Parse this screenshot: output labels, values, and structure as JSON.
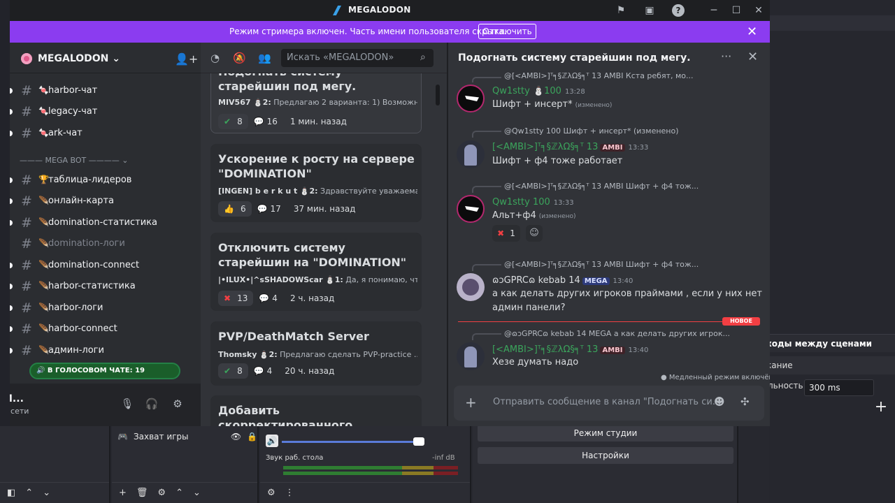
{
  "app": {
    "title": "MEGALODON"
  },
  "banner": {
    "text": "Режим стримера включен. Часть имени пользователя скрыта.",
    "button": "Отключить"
  },
  "server": {
    "name": "MEGALODON"
  },
  "channels": [
    {
      "emoji": "🍬",
      "name": "harbor-чат",
      "muted": false
    },
    {
      "emoji": "🍬",
      "name": "legacy-чат",
      "muted": false
    },
    {
      "emoji": "🍬",
      "name": "ark-чат",
      "muted": false
    },
    {
      "emoji": "🏆",
      "name": "таблица-лидеров",
      "muted": false
    },
    {
      "emoji": "🪶",
      "name": "онлайн-карта",
      "muted": false
    },
    {
      "emoji": "🪶",
      "name": "domination-статистика",
      "muted": false
    },
    {
      "emoji": "🪶",
      "name": "domination-логи",
      "muted": true
    },
    {
      "emoji": "🪶",
      "name": "domination-connect",
      "muted": false
    },
    {
      "emoji": "🪶",
      "name": "harbor-статистика",
      "muted": false
    },
    {
      "emoji": "🪶",
      "name": "harbor-логи",
      "muted": false
    },
    {
      "emoji": "🪶",
      "name": "harbor-connect",
      "muted": false
    },
    {
      "emoji": "🪶",
      "name": "админ-логи",
      "muted": false
    }
  ],
  "category": {
    "label": "——— MEGA BOT ———— ⌄"
  },
  "voice": {
    "label": "🔊 В ГОЛОСОВОМ ЧАТЕ: 19"
  },
  "user": {
    "name": "M...",
    "status": "В сети"
  },
  "forum": {
    "search_placeholder": "Искать «MEGALODON»",
    "posts": [
      {
        "title": "Подогнать систему старейшин под мегу.",
        "author": "MIV567",
        "count": "2:",
        "preview": "Предлагаю 2 варианта: 1) Возможн...",
        "reaction_icon": "✔",
        "reactions": "8",
        "messages": "16",
        "time": "1 мин. назад"
      },
      {
        "title": "Ускорение к росту на сервере \"DOMINATION\"",
        "author": "[INGEN] b e r k u t",
        "count": "2:",
        "preview": "Здравствуйте уважаемая ...",
        "reaction_icon": "👍",
        "reactions": "6",
        "messages": "17",
        "time": "37 мин. назад"
      },
      {
        "title": "Отключить систему старейшин на \"DOMINATION\"",
        "author": "|•ILUX•|^sSHADOWScar",
        "count": "1:",
        "preview": "Да, я понимаю, чт...",
        "reaction_icon": "✖",
        "reactions": "13",
        "messages": "4",
        "time": "2 ч. назад"
      },
      {
        "title": "PVP/DeathMatch Server",
        "author": "Thomsky",
        "count": "2:",
        "preview": "Предлагаю сделать PVP-practice ...",
        "reaction_icon": "✔",
        "reactions": "8",
        "messages": "4",
        "time": "20 ч. назад"
      },
      {
        "title": "Добавить скорректированного взломанного рекса(который",
        "author": "",
        "count": "",
        "preview": "",
        "reaction_icon": "",
        "reactions": "",
        "messages": "",
        "time": ""
      }
    ]
  },
  "thread": {
    "title": "Подогнать систему старейшин под мегу.",
    "new_label": "НОВОЕ",
    "slow_mode": "Медленный режим включён.",
    "composer_placeholder": "Отправить сообщение в канал \"Подогнать си...",
    "messages": [
      {
        "reply": "@[<AMBI>]ᵀ╕§ℤλΩ§╕ᵀ 13 AMBI Кста ребят, мо...",
        "user": "Qw1stty",
        "level": "100",
        "time": "13:28",
        "text": "Шифт + инсерт*",
        "edited": "(изменено)"
      },
      {
        "reply": "@Qw1stty 100 Шифт + инсерт* (изменено)",
        "user": "[<AMBI>]ᵀ╕§ℤλΩ§╕ᵀ",
        "level": "13",
        "badge": "AMBI",
        "time": "13:33",
        "text": "Шифт + ф4 тоже работает",
        "edited": ""
      },
      {
        "reply": "@[<AMBI>]ᵀ╕§ℤλΩ§╕ᵀ 13 AMBI Шифт + ф4 тож...",
        "user": "Qw1stty",
        "level": "100",
        "time": "13:33",
        "text": "Альт+ф4",
        "edited": "(изменено)",
        "reaction": "1"
      },
      {
        "reply": "@[<AMBI>]ᵀ╕§ℤλΩ§╕ᵀ 13 AMBI Шифт + ф4 тож...",
        "user": "ɷɔGPRCɷ kebab",
        "level": "14",
        "badge": "MEGA",
        "time": "13:40",
        "text": "а как делать других игроков праймами , если у них нет админ панели?",
        "text1": "а как делать других игроков праймами , если у них нет",
        "text2": "админ панели?"
      },
      {
        "reply": "@ɷɔGPRCɷ kebab 14 MEGA а как делать других игрок...",
        "user": "[<AMBI>]ᵀ╕§ℤλΩ§╕ᵀ",
        "level": "13",
        "badge": "AMBI",
        "time": "13:40",
        "text": "Хезе думать надо"
      }
    ]
  },
  "obs": {
    "transition_title": "ходы между сценами",
    "transition_name": "кание",
    "duration_label": "льность",
    "duration_value": "300 ms",
    "source": "Захват игры",
    "mixer_title": "Звук раб. стола",
    "mixer_db": "-inf dB",
    "studio_button": "Режим студии",
    "settings_button": "Настройки"
  },
  "colors": {
    "banner": "#8b3cf0",
    "online_green": "#3ba55c",
    "accent_red": "#f23f43"
  }
}
